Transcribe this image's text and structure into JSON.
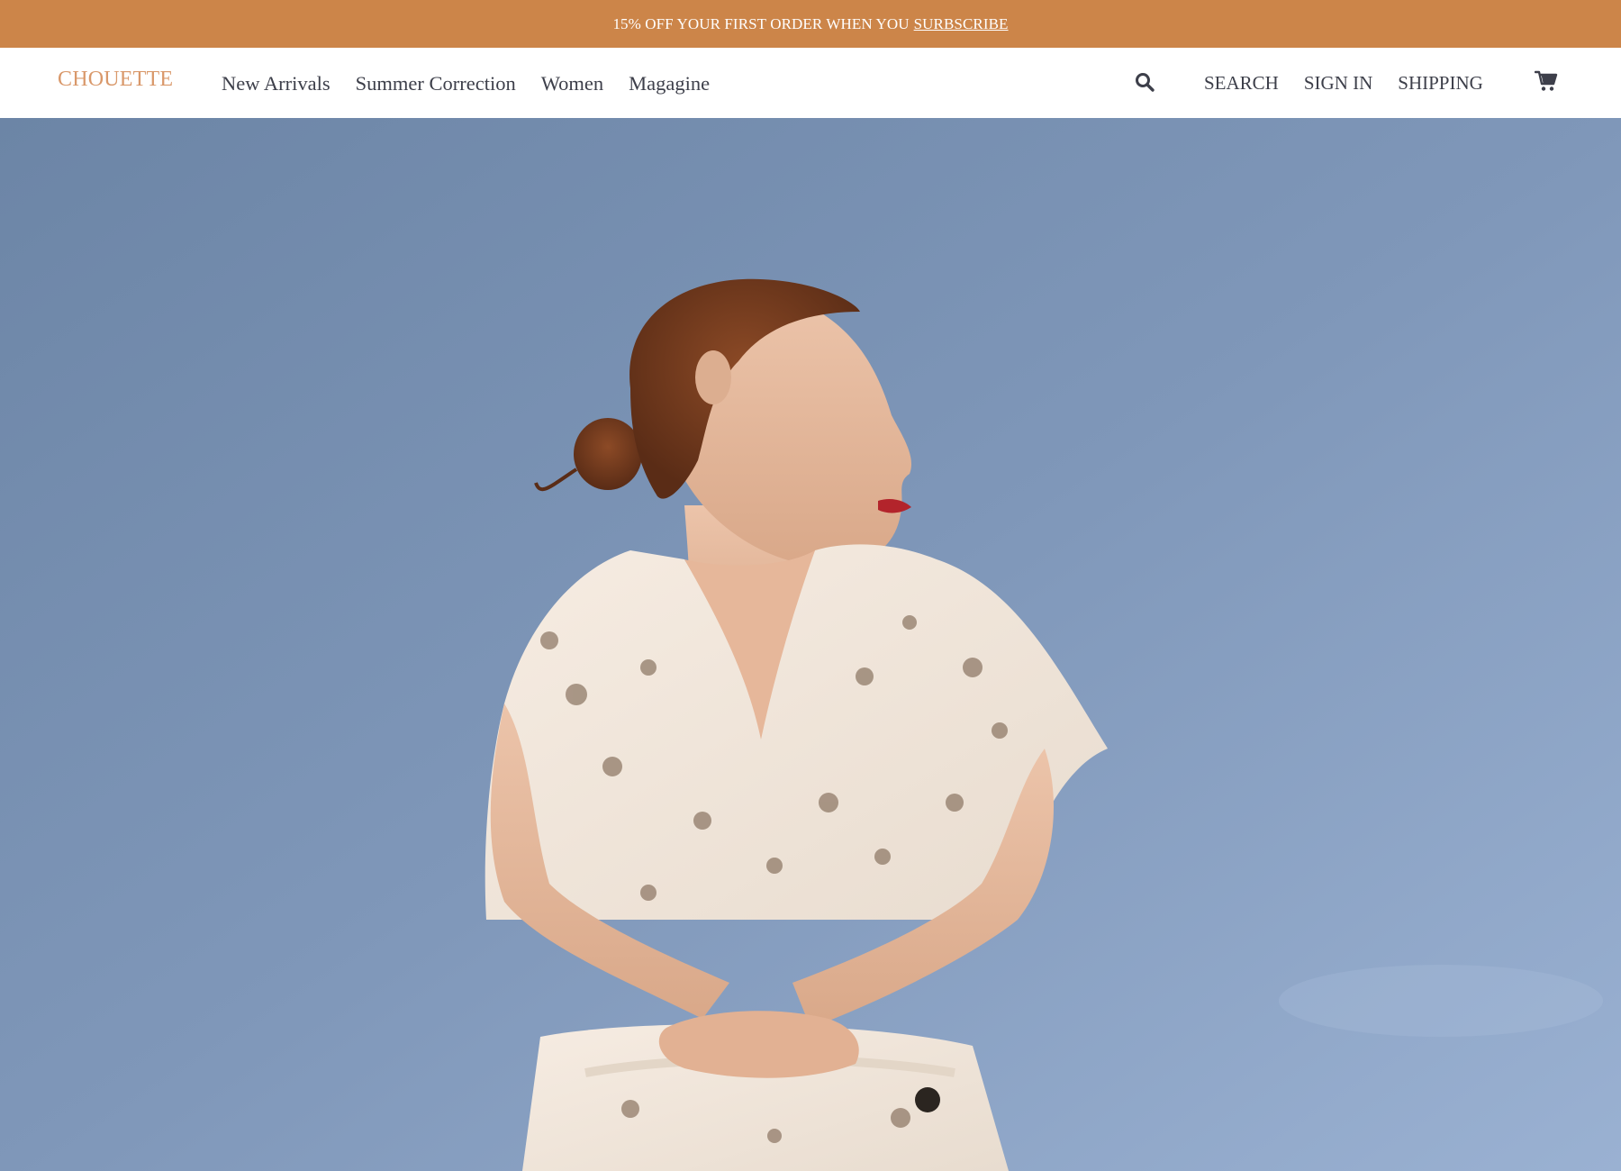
{
  "promo": {
    "text": "15% OFF YOUR FIRST ORDER WHEN YOU",
    "link_label": "SURBSCRIBE"
  },
  "header": {
    "logo": "CHOUETTE",
    "nav": [
      {
        "label": "New Arrivals"
      },
      {
        "label": "Summer Correction"
      },
      {
        "label": "Women"
      },
      {
        "label": "Magagine"
      }
    ],
    "search_icon": "search-icon",
    "utility": [
      {
        "label": "SEARCH"
      },
      {
        "label": "SIGN IN"
      },
      {
        "label": "SHIPPING"
      }
    ],
    "cart_icon": "cart-icon"
  },
  "hero": {
    "image": "woman-in-floral-dress-against-blue-sky"
  },
  "colors": {
    "promo_bg": "#cc8549",
    "logo": "#d9986a",
    "nav_text": "#3d3f4a",
    "sky": "#7d94b6"
  }
}
